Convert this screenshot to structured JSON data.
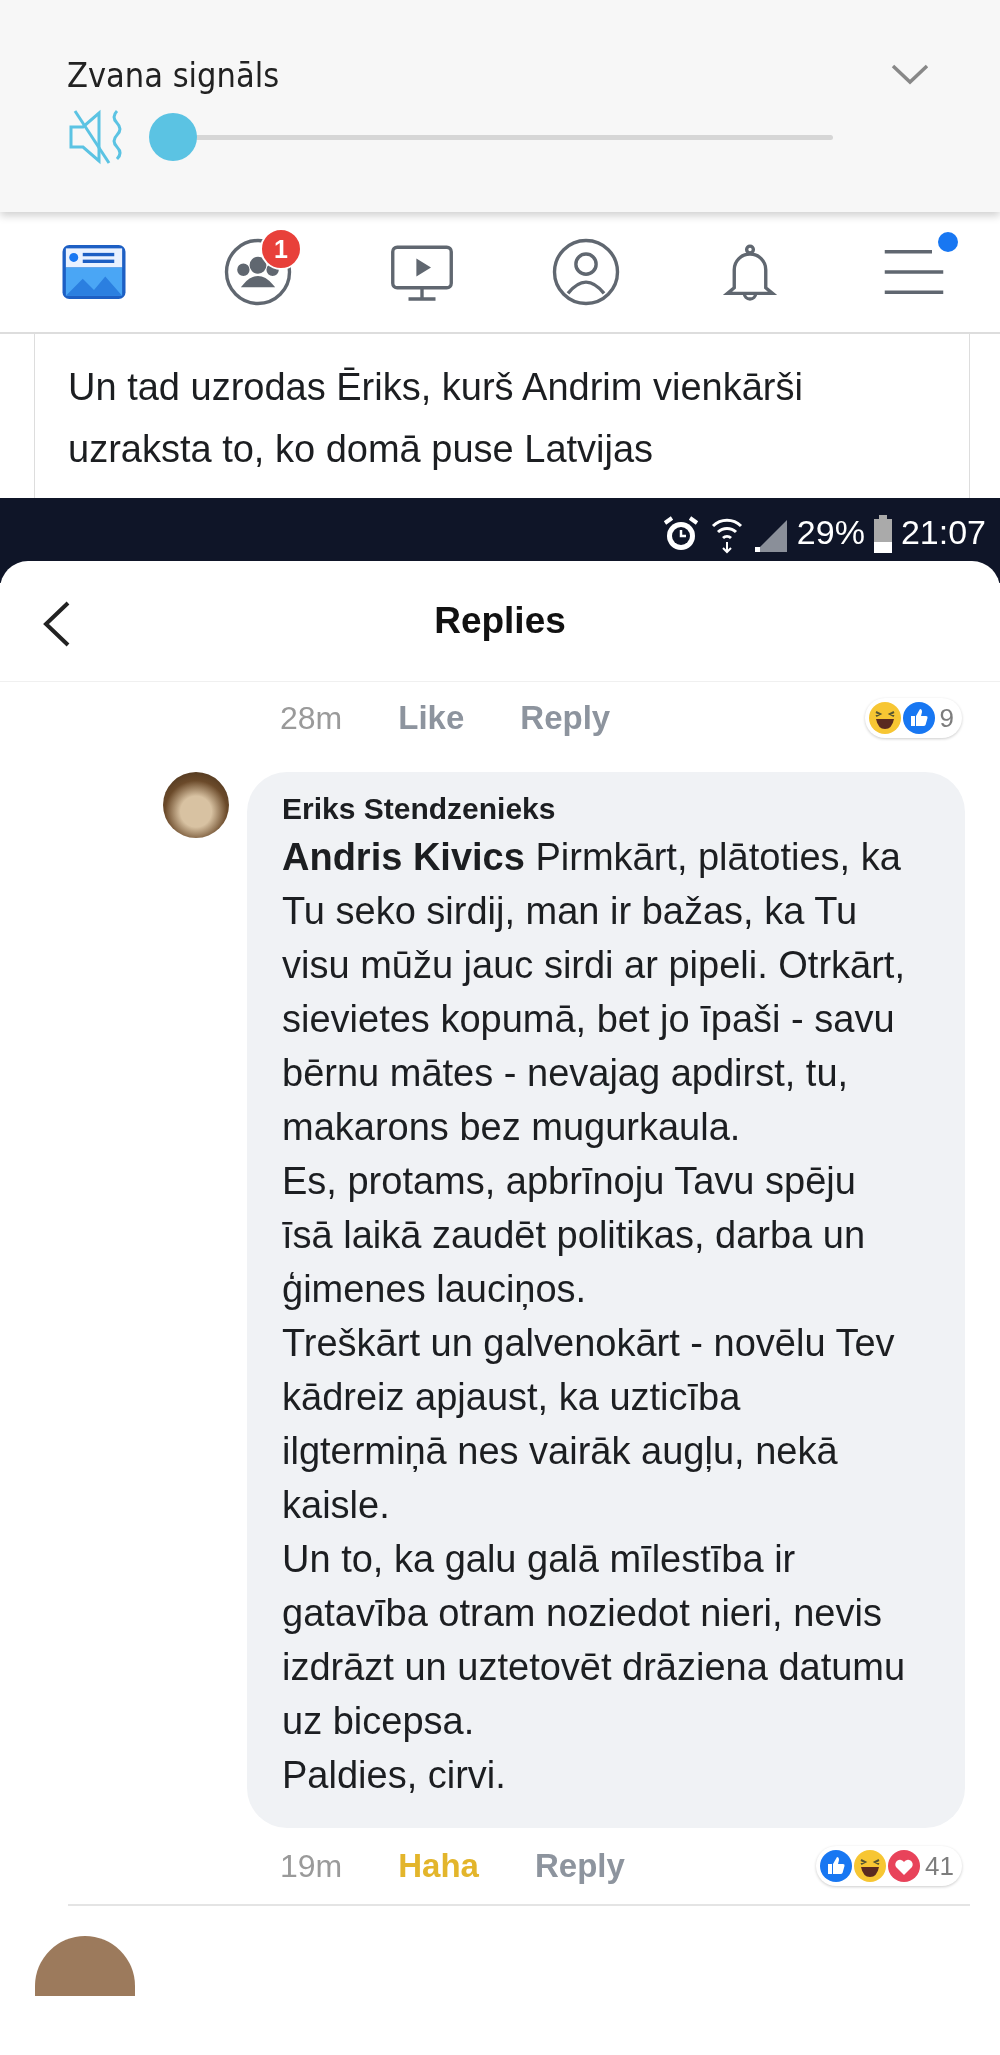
{
  "volume_panel": {
    "title": "Zvana signāls",
    "muted": true,
    "level": 0.0
  },
  "nav": [
    {
      "kind": "feed",
      "selected": true
    },
    {
      "kind": "groups",
      "selected": false,
      "badge": "1"
    },
    {
      "kind": "video",
      "selected": false
    },
    {
      "kind": "profile",
      "selected": false
    },
    {
      "kind": "bell",
      "selected": false
    },
    {
      "kind": "menu",
      "selected": false,
      "dot": true
    }
  ],
  "post": {
    "text": "Un tad uzrodas Ēriks, kurš Andrim vienkārši uzraksta to, ko domā puse Latvijas"
  },
  "screenshot": {
    "status_bar": {
      "battery": "29%",
      "time": "21:07"
    },
    "title": "Replies",
    "previous_comment": {
      "time": "28m",
      "actions": [
        {
          "label": "Like",
          "selected": false
        },
        {
          "label": "Reply",
          "selected": false
        }
      ],
      "reactions": [
        {
          "kind": "haha"
        },
        {
          "kind": "like"
        }
      ],
      "reaction_count": "9"
    },
    "comment": {
      "author": "Eriks Stendzenieks",
      "paragraphs": [
        "**Andris Kivics** Pirmkārt, plātoties, ka Tu seko sirdij, man ir bažas, ka Tu visu mūžu jauc sirdi ar pipeli. Otrkārt, sievietes kopumā, bet jo īpaši - savu bērnu mātes - nevajag apdirst, tu, makarons bez mugurkaula.",
        "Es, protams, apbrīnoju Tavu spēju īsā laikā zaudēt politikas, darba un ģimenes lauciņos.",
        "Treškārt un galvenokārt - novēlu Tev kādreiz apjaust, ka uzticība ilgtermiņā nes vairāk augļu, nekā kaisle.",
        "Un to, ka galu galā mīlestība ir gatavība otram noziedot nieri, nevis izdrāzt un uztetovēt drāziena datumu uz bicepsa.",
        "Paldies, cirvi."
      ],
      "time": "19m",
      "actions": [
        {
          "label": "Haha",
          "selected": true
        },
        {
          "label": "Reply",
          "selected": false
        }
      ],
      "reactions": [
        {
          "kind": "like"
        },
        {
          "kind": "haha"
        },
        {
          "kind": "love"
        }
      ],
      "reaction_count": "41"
    }
  }
}
